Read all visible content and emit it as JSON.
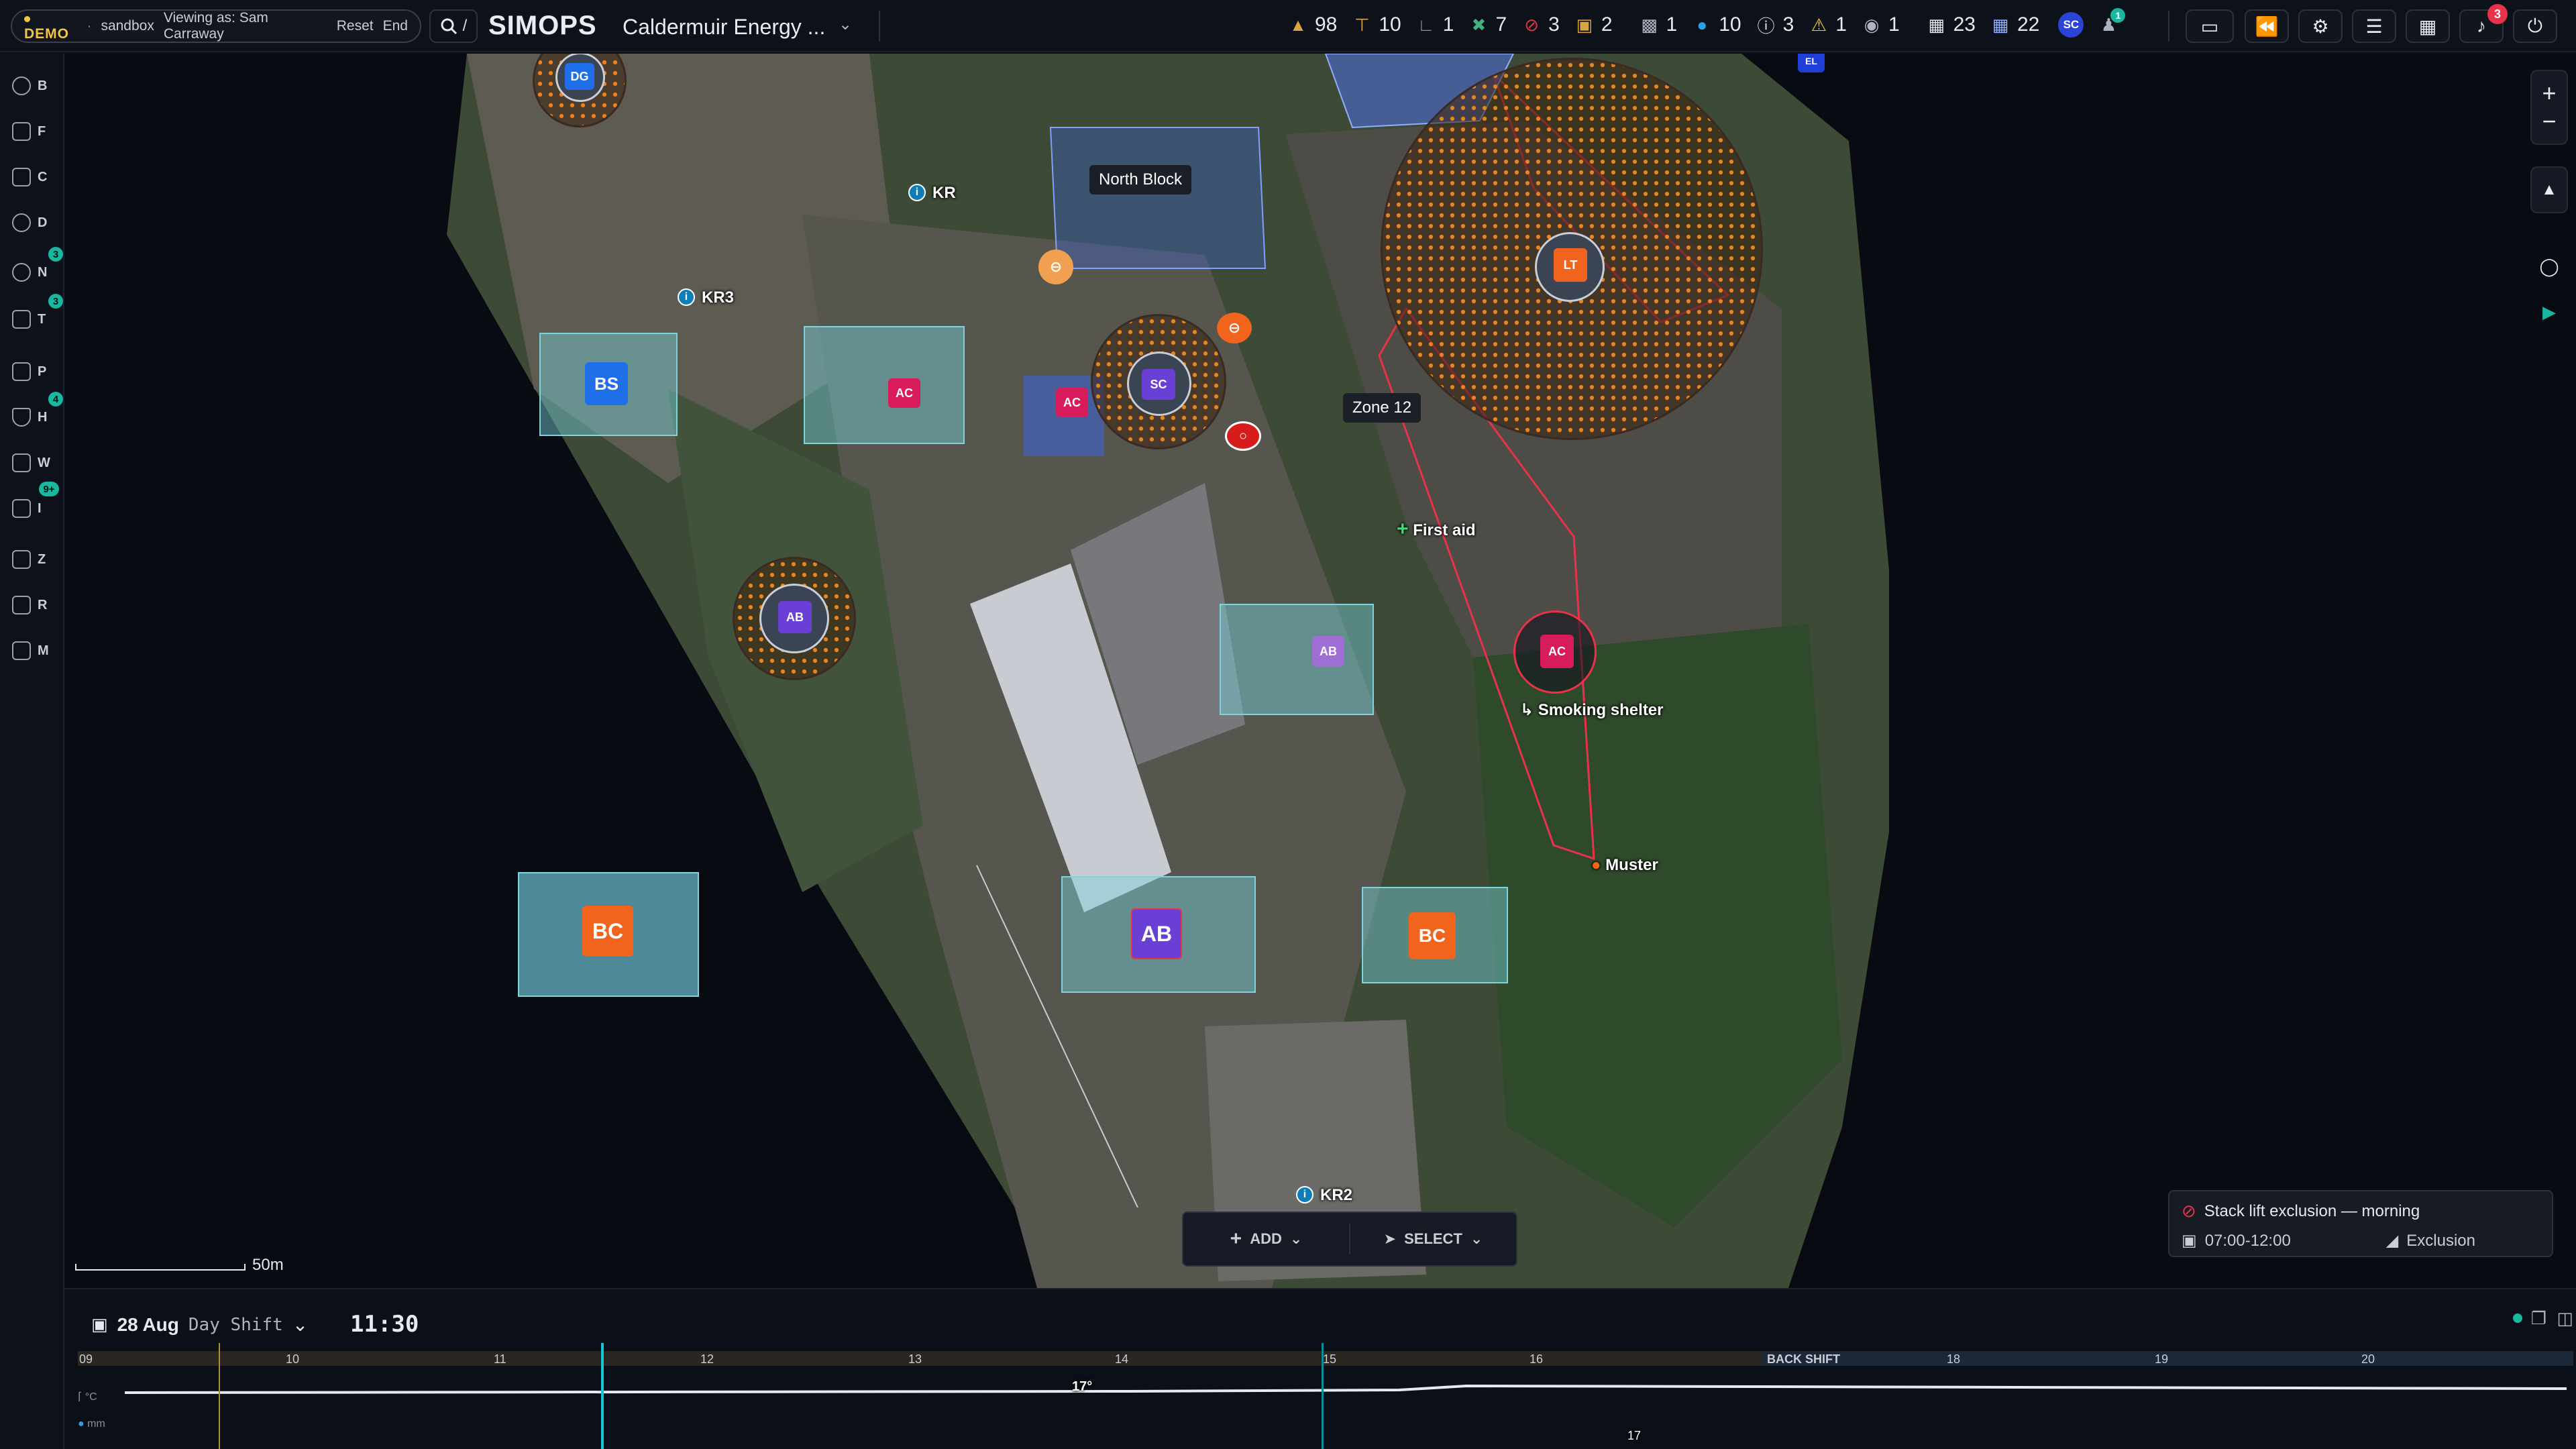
{
  "header": {
    "mode": "DEMO",
    "environment": "sandbox",
    "viewing_as": "Viewing as: Sam Carraway",
    "reset_label": "Reset",
    "end_label": "End",
    "search_shortcut": "/",
    "logo": "SIMOPS",
    "site_name": "Caldermuir Energy ...",
    "stats": [
      {
        "icon": "hardhat-icon",
        "value": "98"
      },
      {
        "icon": "crane-icon",
        "value": "10"
      },
      {
        "icon": "excavator-icon",
        "value": "1"
      },
      {
        "icon": "permit-icon",
        "value": "7"
      },
      {
        "icon": "prohibited-icon",
        "value": "3"
      },
      {
        "icon": "box-icon",
        "value": "2"
      },
      {
        "icon": "truck-icon",
        "value": "1"
      },
      {
        "icon": "location-pin-icon",
        "value": "10"
      },
      {
        "icon": "alert-circle-icon",
        "value": "3"
      },
      {
        "icon": "warning-triangle-icon",
        "value": "1"
      },
      {
        "icon": "eye-icon",
        "value": "1"
      },
      {
        "icon": "building-icon",
        "value": "23"
      },
      {
        "icon": "grid-icon",
        "value": "22"
      }
    ],
    "user_initials": "SC",
    "team_badge": "1",
    "notification_badge": "3"
  },
  "sidebar": {
    "items": [
      {
        "letter": "B",
        "icon": "globe-icon",
        "badge": ""
      },
      {
        "letter": "F",
        "icon": "layers-icon",
        "badge": ""
      },
      {
        "letter": "C",
        "icon": "cog-group-icon",
        "badge": ""
      },
      {
        "letter": "D",
        "icon": "target-icon",
        "badge": ""
      },
      {
        "letter": "N",
        "icon": "info-icon",
        "badge": "3"
      },
      {
        "letter": "T",
        "icon": "edit-icon",
        "badge": "3"
      },
      {
        "letter": "P",
        "icon": "clipboard-icon",
        "badge": ""
      },
      {
        "letter": "H",
        "icon": "shield-icon",
        "badge": "4"
      },
      {
        "letter": "W",
        "icon": "columns-icon",
        "badge": ""
      },
      {
        "letter": "I",
        "icon": "inbox-icon",
        "badge": "9+"
      },
      {
        "letter": "Z",
        "icon": "lock-icon",
        "badge": ""
      },
      {
        "letter": "R",
        "icon": "document-icon",
        "badge": ""
      },
      {
        "letter": "M",
        "icon": "map-icon",
        "badge": ""
      }
    ]
  },
  "map": {
    "labels": {
      "north_block": "North Block",
      "zone12": "Zone 12",
      "first_aid": "First aid",
      "smoking": "Smoking shelter",
      "muster": "Muster",
      "kr3": "KR3",
      "kr2": "KR2",
      "kr1": "KR"
    },
    "tags": {
      "dg": "DG",
      "bs": "BS",
      "ac1": "AC",
      "ac2": "AC",
      "sc": "SC",
      "lt": "LT",
      "ab1": "AB",
      "ab2": "AB",
      "ac3": "AC",
      "bc1": "BC",
      "ab3": "AB",
      "bc2": "BC",
      "el": "EL"
    },
    "scale_label": "50m",
    "toolbar": {
      "add": "ADD",
      "select": "SELECT"
    },
    "notice": {
      "title": "Stack lift exclusion — morning",
      "time": "07:00-12:00",
      "type": "Exclusion"
    }
  },
  "timeline": {
    "date": "28 Aug",
    "shift": "Day Shift",
    "time": "11:30",
    "hours": [
      "09",
      "10",
      "11",
      "12",
      "13",
      "14",
      "15",
      "16",
      "18",
      "19",
      "20"
    ],
    "back_shift": "BACK SHIFT",
    "temp_label": "°C",
    "rain_label": "mm",
    "temp_value": "17°",
    "bottom_value": "17"
  }
}
